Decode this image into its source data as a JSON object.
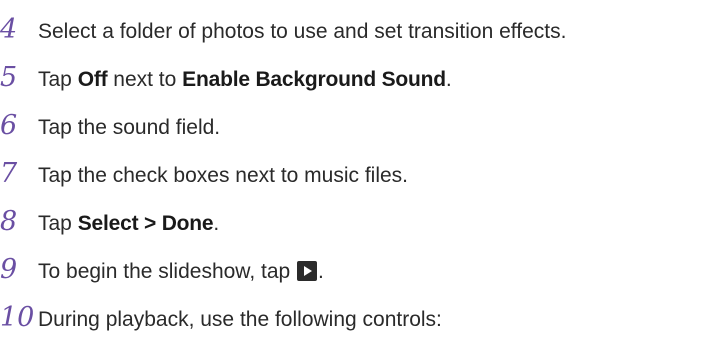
{
  "steps": [
    {
      "number": "4",
      "text": "Select a folder of photos to use and set transition effects."
    },
    {
      "number": "5",
      "prefix": "Tap ",
      "bold1": "Off",
      "middle": " next to ",
      "bold2": "Enable Background Sound",
      "suffix": "."
    },
    {
      "number": "6",
      "text": "Tap the sound field."
    },
    {
      "number": "7",
      "text": "Tap the check boxes next to music files."
    },
    {
      "number": "8",
      "prefix": "Tap ",
      "bold1": "Select > Done",
      "suffix": "."
    },
    {
      "number": "9",
      "prefix": "To begin the slideshow, tap ",
      "icon": "play-icon",
      "suffix": "."
    },
    {
      "number": "10",
      "text": "During playback, use the following controls:"
    }
  ],
  "colors": {
    "step_number": "#6a4fa3",
    "body_text": "#2a2a2a",
    "icon_bg": "#2b2b2b"
  }
}
